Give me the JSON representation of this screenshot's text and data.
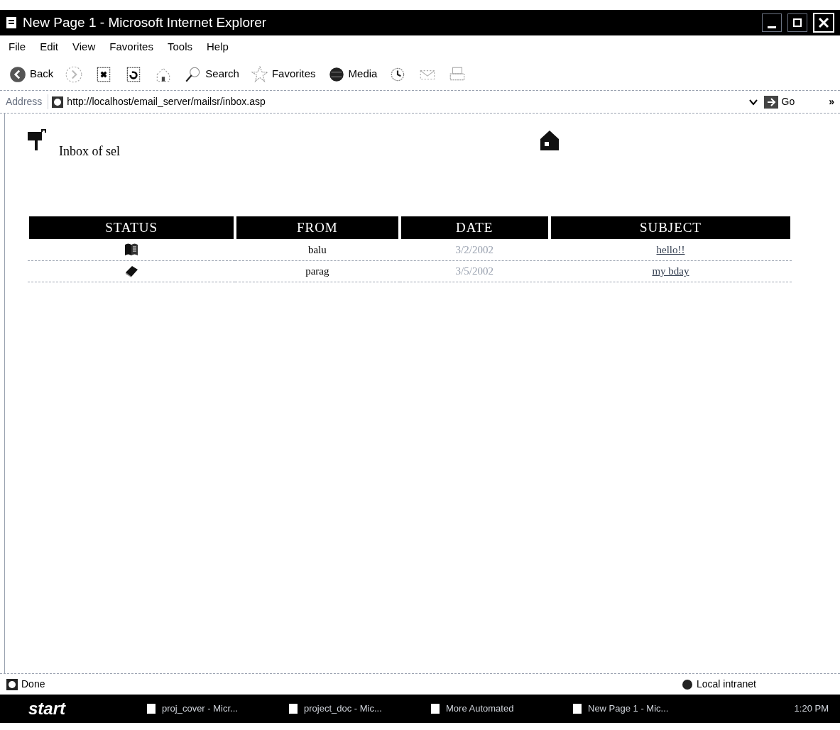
{
  "window": {
    "title": "New Page 1 - Microsoft Internet Explorer"
  },
  "menu": [
    "File",
    "Edit",
    "View",
    "Favorites",
    "Tools",
    "Help"
  ],
  "toolbar": [
    {
      "kind": "back",
      "label": "Back"
    },
    {
      "kind": "forward"
    },
    {
      "kind": "stop"
    },
    {
      "kind": "refresh"
    },
    {
      "kind": "home"
    },
    {
      "kind": "search",
      "label": "Search"
    },
    {
      "kind": "favorites",
      "label": "Favorites"
    },
    {
      "kind": "media",
      "label": "Media"
    },
    {
      "kind": "history"
    },
    {
      "kind": "mail"
    },
    {
      "kind": "print"
    }
  ],
  "address": {
    "label": "Address",
    "value": "http://localhost/email_server/mailsr/inbox.asp",
    "go": "Go",
    "links": "»"
  },
  "page": {
    "heading": "Inbox of sel",
    "table": {
      "columns": [
        "STATUS",
        "FROM",
        "DATE",
        "SUBJECT"
      ],
      "rows": [
        {
          "read": true,
          "from": "balu",
          "date": "3/2/2002",
          "subject": "hello!!"
        },
        {
          "read": false,
          "from": "parag",
          "date": "3/5/2002",
          "subject": "my bday"
        }
      ]
    }
  },
  "status_bar": {
    "text": "Done",
    "zone": "Local intranet"
  },
  "taskbar": {
    "start": "start",
    "tasks": [
      "proj_cover - Micr...",
      "project_doc - Mic...",
      "More Automated",
      "New Page 1 - Mic..."
    ],
    "time": "1:20 PM"
  }
}
